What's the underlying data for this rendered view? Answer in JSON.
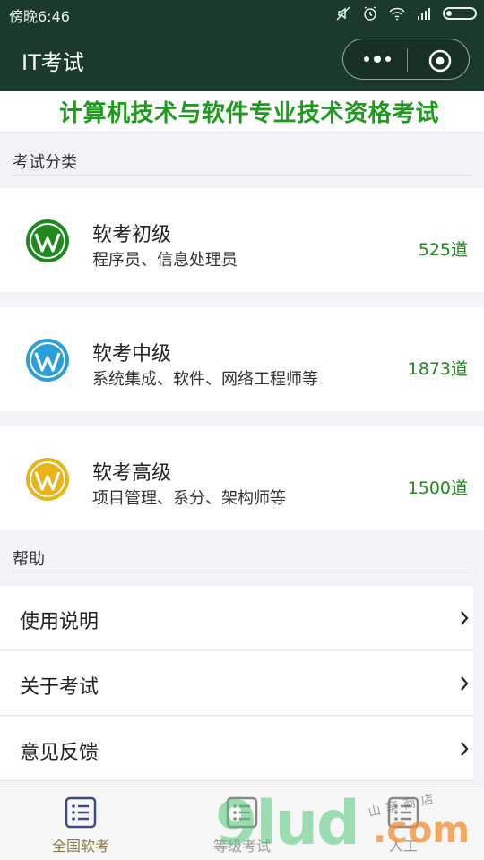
{
  "status_bar": {
    "time": "傍晚6:46"
  },
  "app": {
    "title": "IT考试"
  },
  "banner": {
    "text": "计算机技术与软件专业技术资格考试"
  },
  "sections": {
    "category": "考试分类",
    "help": "帮助"
  },
  "exams": [
    {
      "name": "软考初级",
      "desc": "程序员、信息处理员",
      "count": "525道",
      "color": "#1e8a1e"
    },
    {
      "name": "软考中级",
      "desc": "系统集成、软件、网络工程师等",
      "count": "1873道",
      "color": "#2a9fd8"
    },
    {
      "name": "软考高级",
      "desc": "项目管理、系分、架构师等",
      "count": "1500道",
      "color": "#e8b417"
    }
  ],
  "help_items": [
    {
      "label": "使用说明"
    },
    {
      "label": "关于考试"
    },
    {
      "label": "意见反馈"
    }
  ],
  "tabs": [
    {
      "label": "全国软考",
      "active": true
    },
    {
      "label": "等级考试",
      "active": false
    },
    {
      "label": "人工",
      "active": false
    }
  ],
  "watermark": {
    "main": "9lud",
    "suffix": ".com",
    "handwriting": "山寨商店"
  },
  "colors": {
    "titlebar": "#1c3a2c",
    "banner_text": "#1e9a1e",
    "count_text": "#1e8a1e",
    "active_tab": "#8a7a45"
  }
}
